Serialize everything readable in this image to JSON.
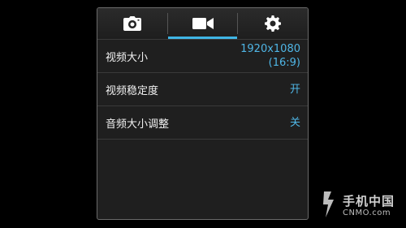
{
  "tabs": [
    {
      "id": "camera",
      "icon": "camera-icon",
      "active": false
    },
    {
      "id": "video",
      "icon": "video-camera-icon",
      "active": true
    },
    {
      "id": "settings",
      "icon": "gear-icon",
      "active": false
    }
  ],
  "settings": {
    "video_size": {
      "label": "视频大小",
      "value_line1": "1920x1080",
      "value_line2": "(16:9)"
    },
    "video_stabilization": {
      "label": "视频稳定度",
      "value": "开"
    },
    "audio_zoom": {
      "label": "音频大小调整",
      "value": "关"
    }
  },
  "colors": {
    "accent": "#3fb5e5",
    "value_text": "#4fb6e6"
  },
  "watermark": {
    "title": "手机中国",
    "subtitle": "CNMO.com"
  }
}
